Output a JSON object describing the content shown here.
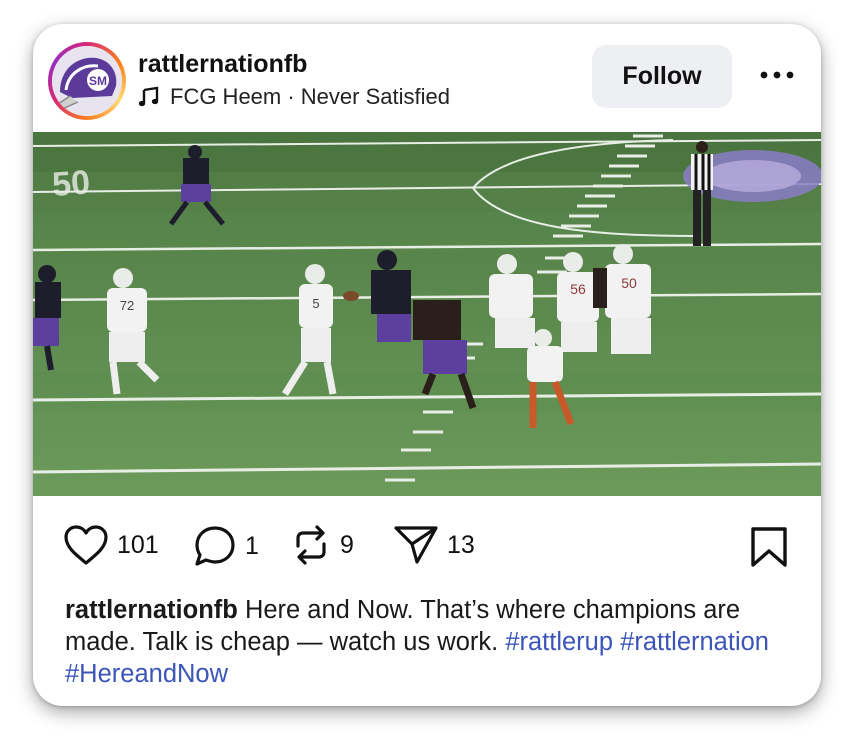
{
  "post": {
    "username": "rattlernationfb",
    "audio": "FCG Heem · Never Satisfied",
    "follow_label": "Follow",
    "video_progress": 0.05,
    "video_muted": true,
    "avatar_initials": "SM"
  },
  "actions": {
    "likes": "101",
    "comments": "1",
    "reposts": "9",
    "shares": "13"
  },
  "caption": {
    "username": "rattlernationfb",
    "text": "Here and Now. That’s where champions are made. Talk is cheap — watch us work.",
    "hashtags": [
      "#rattlerup",
      "#rattlernation",
      "#HereandNow"
    ]
  },
  "colors": {
    "hashtag": "#3b55b8",
    "follow_bg": "#eeeff2",
    "field_green": "#5f8a4f"
  },
  "icons": {
    "more": "more-horizontal-icon",
    "music": "music-note-icon",
    "like": "heart-icon",
    "comment": "comment-bubble-icon",
    "repost": "repost-icon",
    "share": "paper-plane-icon",
    "save": "bookmark-icon",
    "mute": "speaker-muted-icon"
  }
}
